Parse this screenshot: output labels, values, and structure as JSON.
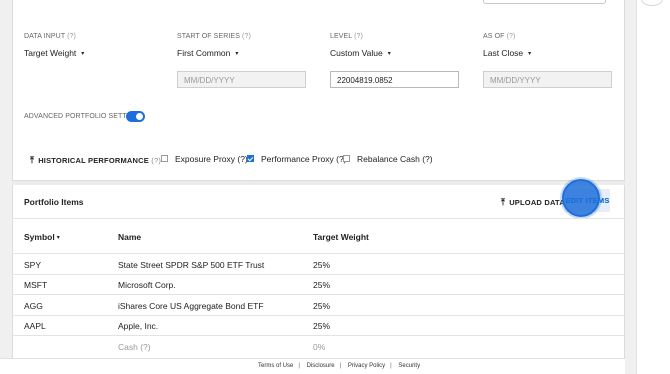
{
  "settings": {
    "data_input": {
      "label": "DATA INPUT",
      "help": "(?)",
      "value": "Target Weight"
    },
    "start_of_series": {
      "label": "START OF SERIES",
      "help": "(?)",
      "value": "First Common",
      "date_placeholder": "MM/DD/YYYY"
    },
    "level": {
      "label": "LEVEL",
      "help": "(?)",
      "value": "Custom Value",
      "input_value": "22004819.0852"
    },
    "as_of": {
      "label": "AS OF",
      "help": "(?)",
      "value": "Last Close",
      "date_placeholder": "MM/DD/YYYY"
    },
    "caret": "▾",
    "advanced_label": "ADVANCED PORTFOLIO SETTINGS",
    "advanced_enabled": true
  },
  "historical": {
    "arrow": "⤒",
    "label": "HISTORICAL PERFORMANCE",
    "help": "(?)",
    "options": [
      {
        "label": "Exposure Proxy (?)",
        "checked": false
      },
      {
        "label": "Performance Proxy (?)",
        "checked": true
      },
      {
        "label": "Rebalance Cash (?)",
        "checked": false
      }
    ]
  },
  "portfolio": {
    "title": "Portfolio Items",
    "upload_label": "UPLOAD DATA",
    "edit_label": "EDIT ITEMS",
    "columns": {
      "symbol": "Symbol",
      "name": "Name",
      "target_weight": "Target Weight"
    },
    "sort_caret": "▾",
    "rows": [
      {
        "symbol": "SPY",
        "name": "State Street SPDR S&P 500 ETF Trust",
        "weight": "25%"
      },
      {
        "symbol": "MSFT",
        "name": "Microsoft Corp.",
        "weight": "25%"
      },
      {
        "symbol": "AGG",
        "name": "iShares Core US Aggregate Bond ETF",
        "weight": "25%"
      },
      {
        "symbol": "AAPL",
        "name": "Apple, Inc.",
        "weight": "25%"
      }
    ],
    "cash_row": {
      "name": "Cash (?)",
      "weight": "0%"
    }
  },
  "footer": {
    "links": [
      "Terms of Use",
      "Disclosure",
      "Privacy Policy",
      "Security"
    ],
    "separator": "|"
  },
  "colors": {
    "accent": "#1e6fd9"
  }
}
